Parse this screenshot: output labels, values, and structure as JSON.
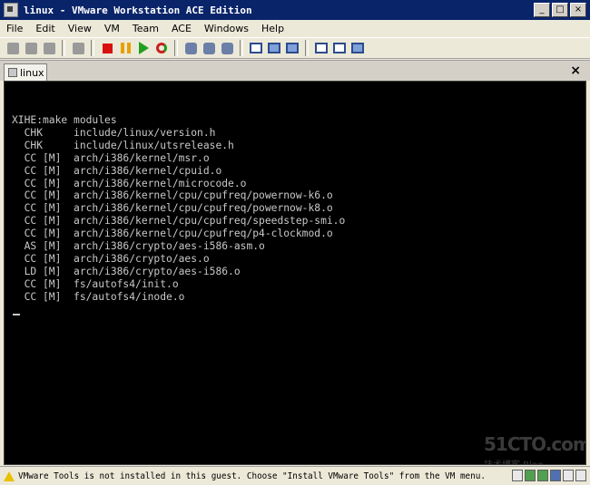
{
  "window": {
    "title": "linux - VMware Workstation ACE Edition",
    "controls": [
      "_",
      "□",
      "×"
    ]
  },
  "menu": [
    "File",
    "Edit",
    "View",
    "VM",
    "Team",
    "ACE",
    "Windows",
    "Help"
  ],
  "toolbar": {
    "icons": [
      "team-power-on-icon",
      "team-power-off-icon",
      "team-settings-icon",
      "capture-icon",
      "power-off-icon",
      "suspend-icon",
      "power-on-icon",
      "reset-icon",
      "snapshot-icon",
      "revert-snapshot-icon",
      "snapshot-manager-icon",
      "show-sidebar-icon",
      "quick-switch-icon",
      "full-screen-icon",
      "summary-view-icon",
      "console-view-icon",
      "appliance-view-icon"
    ]
  },
  "tabs": [
    {
      "label": "linux"
    }
  ],
  "tab_close": "×",
  "console": {
    "lines": [
      "XIHE:make modules",
      "  CHK     include/linux/version.h",
      "  CHK     include/linux/utsrelease.h",
      "  CC [M]  arch/i386/kernel/msr.o",
      "  CC [M]  arch/i386/kernel/cpuid.o",
      "  CC [M]  arch/i386/kernel/microcode.o",
      "  CC [M]  arch/i386/kernel/cpu/cpufreq/powernow-k6.o",
      "  CC [M]  arch/i386/kernel/cpu/cpufreq/powernow-k8.o",
      "  CC [M]  arch/i386/kernel/cpu/cpufreq/speedstep-smi.o",
      "  CC [M]  arch/i386/kernel/cpu/cpufreq/p4-clockmod.o",
      "  AS [M]  arch/i386/crypto/aes-i586-asm.o",
      "  CC [M]  arch/i386/crypto/aes.o",
      "  LD [M]  arch/i386/crypto/aes-i586.o",
      "  CC [M]  fs/autofs4/init.o",
      "  CC [M]  fs/autofs4/inode.o"
    ]
  },
  "watermark": {
    "main": "51CTO.com",
    "sub": "技术博客  Blog"
  },
  "status": {
    "message": "VMware Tools is not installed in this guest. Choose \"Install VMware Tools\" from the VM menu."
  },
  "colors": {
    "titlebar": "#0a246a",
    "console_bg": "#000000",
    "console_fg": "#c8c8c8"
  }
}
